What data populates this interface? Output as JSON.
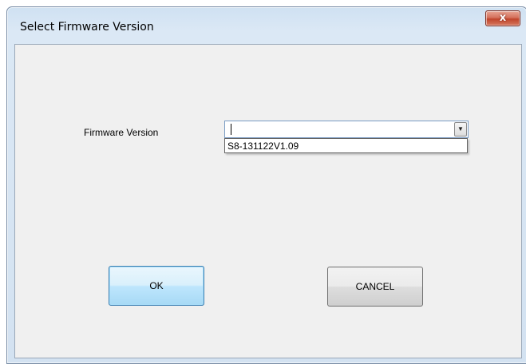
{
  "window": {
    "title": "Select Firmware Version",
    "close_glyph": "x"
  },
  "form": {
    "firmware_label": "Firmware Version",
    "combo_value": "",
    "dropdown_arrow_icon": "chevron-down-icon",
    "options": [
      "S8-131122V1.09"
    ]
  },
  "buttons": {
    "ok_label": "OK",
    "cancel_label": "CANCEL"
  },
  "colors": {
    "window_frame": "#d3e2f1",
    "client_bg": "#f0f0f0",
    "close_button": "#c0452c",
    "default_button_border": "#3c7fb1"
  }
}
